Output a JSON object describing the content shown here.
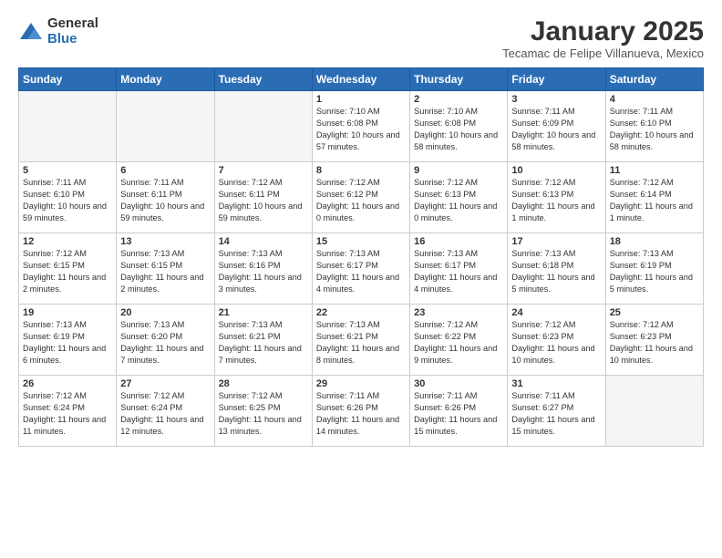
{
  "logo": {
    "general": "General",
    "blue": "Blue"
  },
  "title": "January 2025",
  "subtitle": "Tecamac de Felipe Villanueva, Mexico",
  "days_header": [
    "Sunday",
    "Monday",
    "Tuesday",
    "Wednesday",
    "Thursday",
    "Friday",
    "Saturday"
  ],
  "weeks": [
    [
      {
        "day": "",
        "info": ""
      },
      {
        "day": "",
        "info": ""
      },
      {
        "day": "",
        "info": ""
      },
      {
        "day": "1",
        "info": "Sunrise: 7:10 AM\nSunset: 6:08 PM\nDaylight: 10 hours and 57 minutes."
      },
      {
        "day": "2",
        "info": "Sunrise: 7:10 AM\nSunset: 6:08 PM\nDaylight: 10 hours and 58 minutes."
      },
      {
        "day": "3",
        "info": "Sunrise: 7:11 AM\nSunset: 6:09 PM\nDaylight: 10 hours and 58 minutes."
      },
      {
        "day": "4",
        "info": "Sunrise: 7:11 AM\nSunset: 6:10 PM\nDaylight: 10 hours and 58 minutes."
      }
    ],
    [
      {
        "day": "5",
        "info": "Sunrise: 7:11 AM\nSunset: 6:10 PM\nDaylight: 10 hours and 59 minutes."
      },
      {
        "day": "6",
        "info": "Sunrise: 7:11 AM\nSunset: 6:11 PM\nDaylight: 10 hours and 59 minutes."
      },
      {
        "day": "7",
        "info": "Sunrise: 7:12 AM\nSunset: 6:11 PM\nDaylight: 10 hours and 59 minutes."
      },
      {
        "day": "8",
        "info": "Sunrise: 7:12 AM\nSunset: 6:12 PM\nDaylight: 11 hours and 0 minutes."
      },
      {
        "day": "9",
        "info": "Sunrise: 7:12 AM\nSunset: 6:13 PM\nDaylight: 11 hours and 0 minutes."
      },
      {
        "day": "10",
        "info": "Sunrise: 7:12 AM\nSunset: 6:13 PM\nDaylight: 11 hours and 1 minute."
      },
      {
        "day": "11",
        "info": "Sunrise: 7:12 AM\nSunset: 6:14 PM\nDaylight: 11 hours and 1 minute."
      }
    ],
    [
      {
        "day": "12",
        "info": "Sunrise: 7:12 AM\nSunset: 6:15 PM\nDaylight: 11 hours and 2 minutes."
      },
      {
        "day": "13",
        "info": "Sunrise: 7:13 AM\nSunset: 6:15 PM\nDaylight: 11 hours and 2 minutes."
      },
      {
        "day": "14",
        "info": "Sunrise: 7:13 AM\nSunset: 6:16 PM\nDaylight: 11 hours and 3 minutes."
      },
      {
        "day": "15",
        "info": "Sunrise: 7:13 AM\nSunset: 6:17 PM\nDaylight: 11 hours and 4 minutes."
      },
      {
        "day": "16",
        "info": "Sunrise: 7:13 AM\nSunset: 6:17 PM\nDaylight: 11 hours and 4 minutes."
      },
      {
        "day": "17",
        "info": "Sunrise: 7:13 AM\nSunset: 6:18 PM\nDaylight: 11 hours and 5 minutes."
      },
      {
        "day": "18",
        "info": "Sunrise: 7:13 AM\nSunset: 6:19 PM\nDaylight: 11 hours and 5 minutes."
      }
    ],
    [
      {
        "day": "19",
        "info": "Sunrise: 7:13 AM\nSunset: 6:19 PM\nDaylight: 11 hours and 6 minutes."
      },
      {
        "day": "20",
        "info": "Sunrise: 7:13 AM\nSunset: 6:20 PM\nDaylight: 11 hours and 7 minutes."
      },
      {
        "day": "21",
        "info": "Sunrise: 7:13 AM\nSunset: 6:21 PM\nDaylight: 11 hours and 7 minutes."
      },
      {
        "day": "22",
        "info": "Sunrise: 7:13 AM\nSunset: 6:21 PM\nDaylight: 11 hours and 8 minutes."
      },
      {
        "day": "23",
        "info": "Sunrise: 7:12 AM\nSunset: 6:22 PM\nDaylight: 11 hours and 9 minutes."
      },
      {
        "day": "24",
        "info": "Sunrise: 7:12 AM\nSunset: 6:23 PM\nDaylight: 11 hours and 10 minutes."
      },
      {
        "day": "25",
        "info": "Sunrise: 7:12 AM\nSunset: 6:23 PM\nDaylight: 11 hours and 10 minutes."
      }
    ],
    [
      {
        "day": "26",
        "info": "Sunrise: 7:12 AM\nSunset: 6:24 PM\nDaylight: 11 hours and 11 minutes."
      },
      {
        "day": "27",
        "info": "Sunrise: 7:12 AM\nSunset: 6:24 PM\nDaylight: 11 hours and 12 minutes."
      },
      {
        "day": "28",
        "info": "Sunrise: 7:12 AM\nSunset: 6:25 PM\nDaylight: 11 hours and 13 minutes."
      },
      {
        "day": "29",
        "info": "Sunrise: 7:11 AM\nSunset: 6:26 PM\nDaylight: 11 hours and 14 minutes."
      },
      {
        "day": "30",
        "info": "Sunrise: 7:11 AM\nSunset: 6:26 PM\nDaylight: 11 hours and 15 minutes."
      },
      {
        "day": "31",
        "info": "Sunrise: 7:11 AM\nSunset: 6:27 PM\nDaylight: 11 hours and 15 minutes."
      },
      {
        "day": "",
        "info": ""
      }
    ]
  ]
}
